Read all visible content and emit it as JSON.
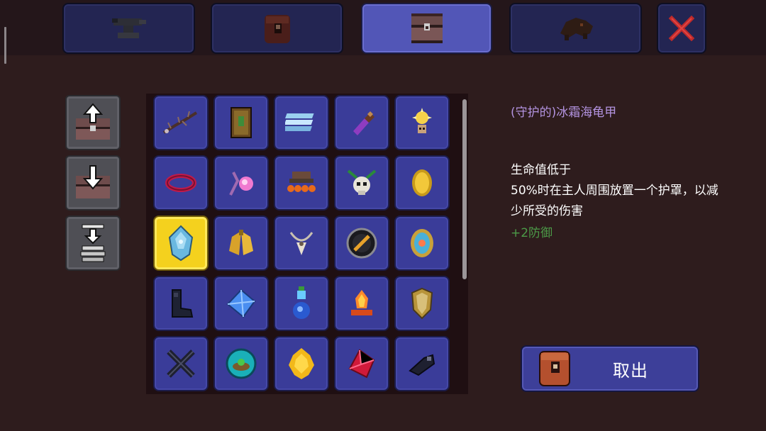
{
  "top_tabs": [
    {
      "name": "anvil-tab",
      "icon": "anvil-icon",
      "active": false
    },
    {
      "name": "piggy-bank-tab",
      "icon": "leather-bag-icon",
      "active": false
    },
    {
      "name": "chest-tab",
      "icon": "chest-icon",
      "active": true
    },
    {
      "name": "bestiary-tab",
      "icon": "creature-icon",
      "active": false
    }
  ],
  "close_icon": "red-x-icon",
  "side_buttons": [
    {
      "name": "deposit-all-button",
      "icon": "chest-up-arrow-icon"
    },
    {
      "name": "loot-all-button",
      "icon": "chest-down-arrow-icon"
    },
    {
      "name": "quick-stack-button",
      "icon": "stack-down-arrow-icon"
    }
  ],
  "inventory": {
    "selected_index": 10,
    "items": [
      "spiked-branch-icon",
      "spell-tome-icon",
      "frost-bars-icon",
      "purple-flask-icon",
      "golden-sun-charm-icon",
      "red-band-icon",
      "pink-orb-staff-icon",
      "orange-frog-crown-icon",
      "jester-skull-icon",
      "gold-coin-medal-icon",
      "frozen-turtle-shell-icon",
      "golden-bell-wings-icon",
      "horned-amulet-icon",
      "sword-shield-emblem-icon",
      "radiant-mirror-icon",
      "dark-boots-icon",
      "blue-crystal-icon",
      "blue-potion-icon",
      "flame-crystal-icon",
      "golden-shield-icon",
      "crossed-claws-icon",
      "teal-orb-nest-icon",
      "golden-fleece-icon",
      "red-gem-icon",
      "shadow-gauntlet-icon"
    ]
  },
  "tooltip": {
    "name": "(守护的)冰霜海龟甲",
    "desc_lines": [
      "生命值低于",
      "50%时在主人周围放置一个护罩，以减",
      "少所受的伤害"
    ],
    "defense": "+2防御"
  },
  "withdraw_button": {
    "label": "取出",
    "icon": "leather-bag-icon"
  },
  "colors": {
    "background": "#2e1c1d",
    "slot_blue": "#3a3c99",
    "slot_selected": "#f4d11e",
    "name_purple": "#b393e0",
    "defense_green": "#4c9b48"
  }
}
